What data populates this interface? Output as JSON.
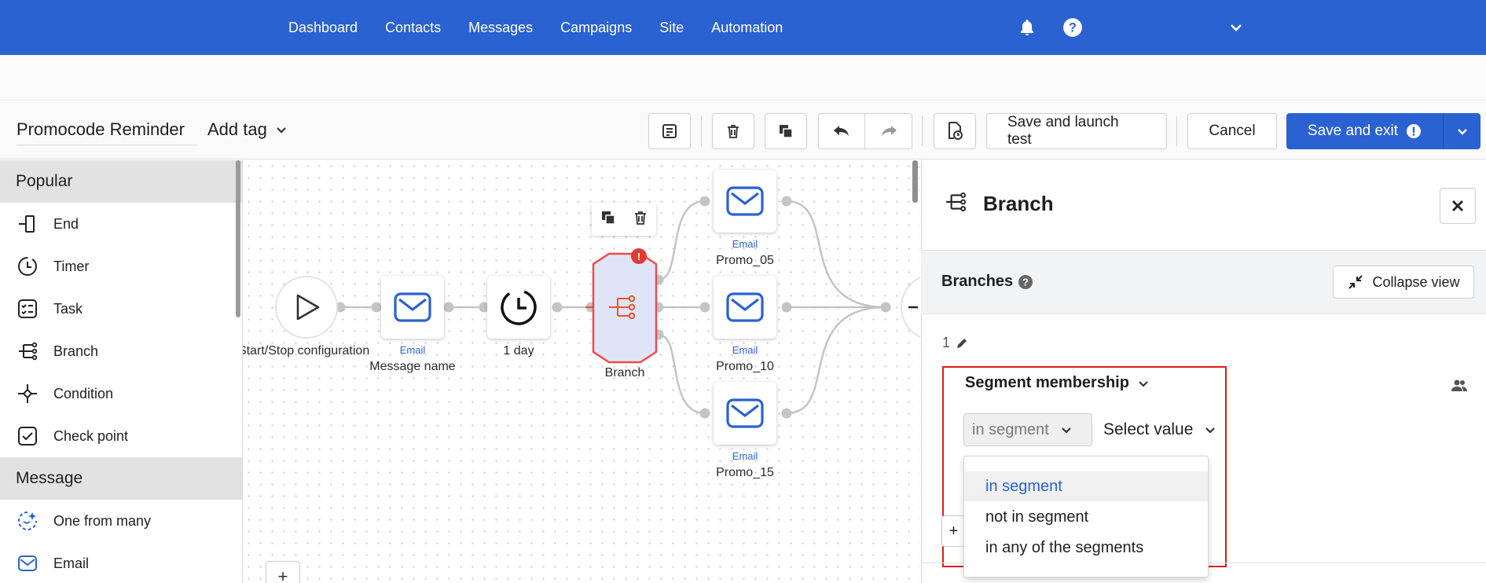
{
  "nav": {
    "items": [
      "Dashboard",
      "Contacts",
      "Messages",
      "Campaigns",
      "Site",
      "Automation"
    ],
    "icons": [
      "bell-icon",
      "help-icon",
      "chevron-down-icon"
    ]
  },
  "toolbar": {
    "workflow_name": "Promocode Reminder",
    "add_tag": "Add tag",
    "save_launch_test": "Save and launch test",
    "cancel": "Cancel",
    "save_exit": "Save and exit",
    "icons": [
      "notes-icon",
      "trash-icon",
      "copy-icon",
      "undo-icon",
      "redo-icon",
      "history-icon",
      "warning-icon",
      "chevron-down-icon"
    ]
  },
  "palette": {
    "sections": [
      {
        "title": "Popular",
        "items": [
          {
            "label": "End",
            "icon": "end-icon"
          },
          {
            "label": "Timer",
            "icon": "timer-icon"
          },
          {
            "label": "Task",
            "icon": "task-icon"
          },
          {
            "label": "Branch",
            "icon": "branch-icon"
          },
          {
            "label": "Condition",
            "icon": "condition-icon"
          },
          {
            "label": "Check point",
            "icon": "checkpoint-icon"
          }
        ]
      },
      {
        "title": "Message",
        "items": [
          {
            "label": "One from many",
            "icon": "one-from-many-icon"
          },
          {
            "label": "Email",
            "icon": "email-icon"
          }
        ]
      }
    ]
  },
  "canvas": {
    "start_label": "Start/Stop configuration",
    "email_node": {
      "type": "Email",
      "name": "Message name"
    },
    "timer_node": {
      "label": "1 day"
    },
    "branch_node": {
      "label": "Branch",
      "warning": "!"
    },
    "promo_nodes": [
      {
        "type": "Email",
        "name": "Promo_05"
      },
      {
        "type": "Email",
        "name": "Promo_10"
      },
      {
        "type": "Email",
        "name": "Promo_15"
      }
    ],
    "add": "+"
  },
  "panel": {
    "title": "Branch",
    "branches_label": "Branches",
    "collapse_view": "Collapse view",
    "branch_number": "1",
    "condition_title": "Segment membership",
    "operator_value": "in segment",
    "value_placeholder": "Select value",
    "operator_options": [
      {
        "label": "in segment",
        "selected": true
      },
      {
        "label": "not in segment",
        "selected": false
      },
      {
        "label": "in any of the segments",
        "selected": false
      }
    ],
    "add_plus": "+"
  },
  "colors": {
    "brand": "#2b62d1",
    "branch_accent": "#e8552f",
    "highlight": "#e01b1b",
    "warning": "#e53935"
  }
}
